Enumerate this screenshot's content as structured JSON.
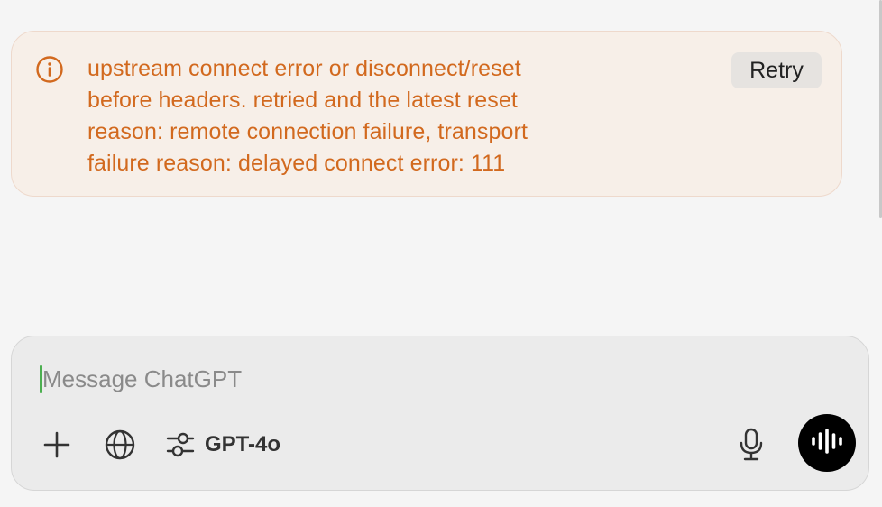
{
  "error": {
    "message": "upstream connect error or disconnect/reset\nbefore headers. retried and the latest reset\nreason: remote connection failure, transport\nfailure reason: delayed connect error: 111",
    "icon": "info-circle-icon",
    "retry_label": "Retry",
    "color": "#d2691e"
  },
  "composer": {
    "placeholder": "Message ChatGPT",
    "value": "",
    "tools": {
      "attach_icon": "plus-icon",
      "search_icon": "globe-icon",
      "model_icon": "sliders-icon",
      "model_label": "GPT-4o",
      "mic_icon": "microphone-icon",
      "voice_icon": "voice-waveform-icon"
    }
  }
}
